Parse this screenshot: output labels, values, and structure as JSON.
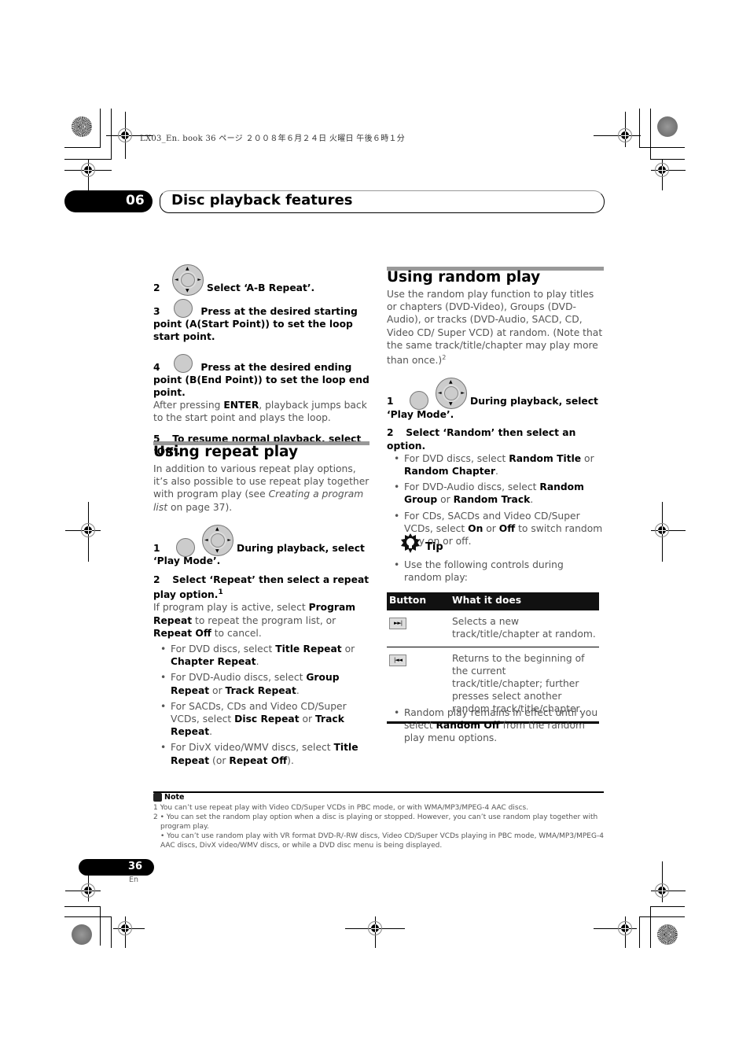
{
  "print_info": "LX03_En. book   36 ページ   ２００８年６月２４日   火曜日   午後６時１分",
  "chapter": {
    "number": "06",
    "title": "Disc playback features"
  },
  "left_column": {
    "ab_steps": [
      {
        "num": "2",
        "text": "Select ‘A-B Repeat’."
      },
      {
        "num": "3",
        "text": "Press at the desired starting point (A(Start Point)) to set the loop start point."
      },
      {
        "num": "4",
        "text": "Press at the desired ending point (B(End Point)) to set the loop end point."
      }
    ],
    "after_pressing": {
      "pre": "After pressing ",
      "bold": "ENTER",
      "post": ", playback jumps back to the start point and plays the loop."
    },
    "step5": {
      "num": "5",
      "text": "To resume normal playback, select ‘Off’."
    },
    "repeat_section": {
      "heading": "Using repeat play",
      "intro_pre": "In addition to various repeat play options, it’s also possible to use repeat play together with program play (see ",
      "intro_italic": "Creating a program list",
      "intro_post": " on page 37).",
      "step1": {
        "num": "1",
        "text": "During playback, select ‘Play Mode’."
      },
      "step2": {
        "num": "2",
        "text": "Select ‘Repeat’ then select a repeat play option.",
        "footnote": "1"
      },
      "program_text": {
        "p1": "If program play is active, select ",
        "b1": "Program Repeat",
        "p2": " to repeat the program list, or ",
        "b2": "Repeat Off",
        "p3": " to cancel."
      },
      "bullets": [
        {
          "t1": "For DVD discs, select ",
          "b1": "Title Repeat",
          "t2": " or ",
          "b2": "Chapter Repeat",
          "t3": "."
        },
        {
          "t1": "For DVD-Audio discs, select ",
          "b1": "Group Repeat",
          "t2": " or ",
          "b2": "Track Repeat",
          "t3": "."
        },
        {
          "t1": "For SACDs, CDs and Video CD/Super VCDs, select ",
          "b1": "Disc Repeat",
          "t2": " or ",
          "b2": "Track Repeat",
          "t3": "."
        },
        {
          "t1": "For DivX video/WMV discs, select ",
          "b1": "Title Repeat",
          "t2": " (or ",
          "b2": "Repeat Off",
          "t3": ")."
        }
      ]
    }
  },
  "right_column": {
    "random_section": {
      "heading": "Using random play",
      "intro": "Use the random play function to play titles or chapters (DVD-Video), Groups (DVD-Audio), or tracks (DVD-Audio, SACD, CD, Video CD/ Super VCD) at random. (Note that the same track/title/chapter may play more than once.)",
      "intro_footnote": "2",
      "step1": {
        "num": "1",
        "text": "During playback, select ‘Play Mode’."
      },
      "step2": {
        "num": "2",
        "text": "Select ‘Random’ then select an option."
      },
      "bullets": [
        {
          "t1": "For DVD discs, select ",
          "b1": "Random Title",
          "t2": " or ",
          "b2": "Random Chapter",
          "t3": "."
        },
        {
          "t1": "For DVD-Audio discs, select ",
          "b1": "Random Group",
          "t2": " or ",
          "b2": "Random Track",
          "t3": "."
        },
        {
          "t1": "For CDs, SACDs and Video CD/Super VCDs, select ",
          "b1": "On",
          "t2": " or ",
          "b2": "Off",
          "t3": " to switch random play on or off."
        }
      ]
    },
    "tip": {
      "label": "Tip",
      "bullet": "Use the following controls during random play:",
      "table": {
        "headers": [
          "Button",
          "What it does"
        ],
        "rows": [
          {
            "icon": "next-track-icon",
            "glyph": "►►|",
            "text": "Selects a new track/title/chapter at random."
          },
          {
            "icon": "previous-track-icon",
            "glyph": "|◄◄",
            "text": "Returns to the beginning of the current track/title/chapter; further presses select another random track/title/chapter."
          }
        ]
      },
      "after": {
        "t1": "Random play remains in effect until you select ",
        "b1": "Random Off",
        "t2": " from the random play menu options."
      }
    }
  },
  "notes": {
    "title": "Note",
    "items": [
      "1 You can’t use repeat play with Video CD/Super VCDs in PBC mode, or with WMA/MP3/MPEG-4 AAC discs.",
      "2 • You can set the random play option when a disc is playing or stopped. However, you can’t use random play together with program play.",
      "• You can’t use random play with VR format DVD-R/-RW discs, Video CD/Super VCDs playing in PBC mode, WMA/MP3/MPEG-4 AAC discs, DivX video/WMV discs, or while a DVD disc menu is being displayed."
    ]
  },
  "footer": {
    "page_number": "36",
    "language": "En"
  }
}
